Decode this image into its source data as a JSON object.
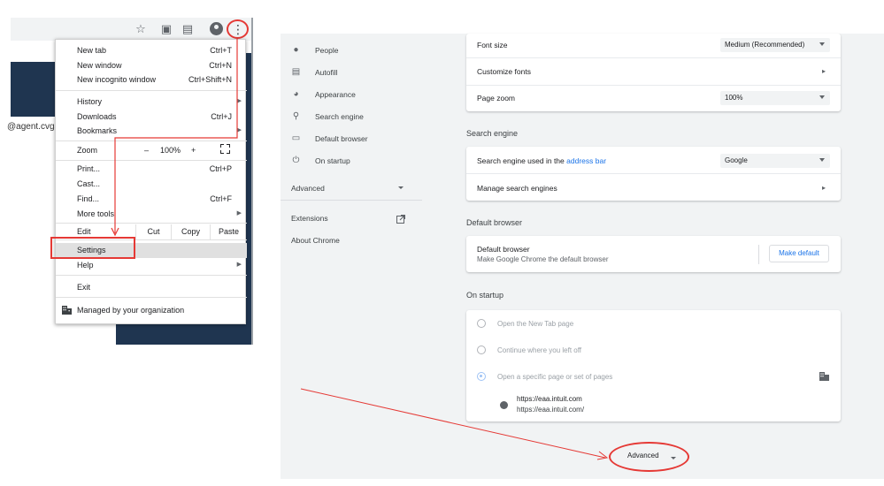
{
  "left_panel": {
    "email_fragment": "@agent.cvgs.",
    "menu": {
      "items": [
        {
          "label": "New tab",
          "shortcut": "Ctrl+T"
        },
        {
          "label": "New window",
          "shortcut": "Ctrl+N"
        },
        {
          "label": "New incognito window",
          "shortcut": "Ctrl+Shift+N"
        },
        {
          "label": "History",
          "shortcut": ""
        },
        {
          "label": "Downloads",
          "shortcut": "Ctrl+J"
        },
        {
          "label": "Bookmarks",
          "shortcut": ""
        },
        {
          "label": "Print...",
          "shortcut": "Ctrl+P"
        },
        {
          "label": "Cast...",
          "shortcut": ""
        },
        {
          "label": "Find...",
          "shortcut": "Ctrl+F"
        },
        {
          "label": "More tools",
          "shortcut": ""
        },
        {
          "label": "Settings",
          "shortcut": ""
        },
        {
          "label": "Help",
          "shortcut": ""
        },
        {
          "label": "Exit",
          "shortcut": ""
        },
        {
          "label": "Managed by your organization",
          "shortcut": ""
        }
      ],
      "zoom": {
        "label": "Zoom",
        "minus": "–",
        "value": "100%",
        "plus": "+"
      },
      "edit": {
        "label": "Edit",
        "cut": "Cut",
        "copy": "Copy",
        "paste": "Paste"
      }
    }
  },
  "settings": {
    "nav": {
      "people": "People",
      "autofill": "Autofill",
      "appearance": "Appearance",
      "search_engine": "Search engine",
      "default_browser": "Default browser",
      "on_startup": "On startup",
      "advanced": "Advanced",
      "extensions": "Extensions",
      "about": "About Chrome"
    },
    "appearance": {
      "font_size_label": "Font size",
      "font_size_value": "Medium (Recommended)",
      "customize_fonts": "Customize fonts",
      "page_zoom_label": "Page zoom",
      "page_zoom_value": "100%"
    },
    "search_engine": {
      "title": "Search engine",
      "used_label": "Search engine used in the ",
      "used_link": "address bar",
      "value": "Google",
      "manage": "Manage search engines"
    },
    "default_browser": {
      "title": "Default browser",
      "label": "Default browser",
      "sub": "Make Google Chrome the default browser",
      "button": "Make default"
    },
    "on_startup": {
      "title": "On startup",
      "options": [
        "Open the New Tab page",
        "Continue where you left off",
        "Open a specific page or set of pages"
      ],
      "selected_index": 2,
      "page_title": "https://eaa.intuit.com",
      "page_url": "https://eaa.intuit.com/"
    },
    "advanced_button": "Advanced"
  },
  "colors": {
    "accent": "#1a73e8",
    "annotation": "#e53935",
    "dark_bg": "#1f3550"
  }
}
